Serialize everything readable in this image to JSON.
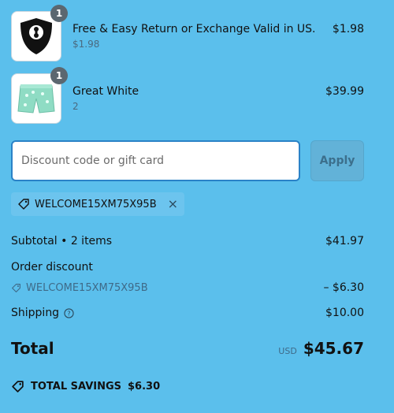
{
  "items": [
    {
      "title": "Free & Easy Return or Exchange Valid in US.",
      "subtitle": "$1.98",
      "price": "$1.98",
      "quantity": "1",
      "thumbnail_icon": "shield-keyhole-icon"
    },
    {
      "title": "Great White",
      "subtitle": "2",
      "price": "$39.99",
      "quantity": "1",
      "thumbnail_icon": "shorts-icon"
    }
  ],
  "discount": {
    "placeholder": "Discount code or gift card",
    "value": "",
    "apply_label": "Apply",
    "applied_code": "WELCOME15XM75X95B"
  },
  "summary": {
    "subtotal_label": "Subtotal • 2 items",
    "subtotal_value": "$41.97",
    "order_discount_label": "Order discount",
    "discount_code": "WELCOME15XM75X95B",
    "discount_value": "– $6.30",
    "shipping_label": "Shipping",
    "shipping_value": "$10.00",
    "total_label": "Total",
    "currency": "USD",
    "total_value": "$45.67",
    "savings_label": "TOTAL SAVINGS",
    "savings_value": "$6.30"
  },
  "colors": {
    "background": "#5bbfec",
    "input_border": "#2a82c7",
    "badge": "#5b6770"
  }
}
